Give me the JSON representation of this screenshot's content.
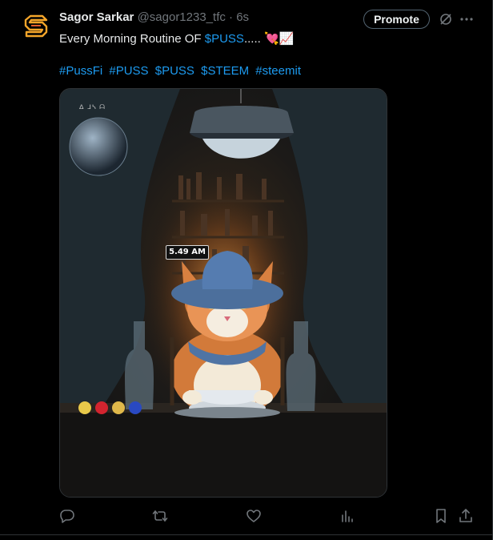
{
  "author": {
    "name": "Sagor Sarkar",
    "handle": "@sagor1233_tfc",
    "separator": "·",
    "time": "6s"
  },
  "header": {
    "promote_label": "Promote"
  },
  "tweet": {
    "text_prefix": "Every Morning Routine OF ",
    "cashtag": "$PUSS",
    "text_suffix": "..... 💘📈",
    "hashtags": [
      "#PussFi",
      "#PUSS",
      "$PUSS",
      "$STEEM",
      "#steemit"
    ]
  },
  "media": {
    "clock_text": "5.49 AM",
    "corner_text": "ᐃ ᒧᓴ ᗩ"
  },
  "colors": {
    "accent": "#1d9bf0",
    "background": "#000000",
    "muted": "#71767b",
    "text": "#e7e9ea"
  },
  "actions": [
    "reply-icon",
    "retweet-icon",
    "like-icon",
    "views-icon",
    "bookmark-icon",
    "share-icon"
  ]
}
